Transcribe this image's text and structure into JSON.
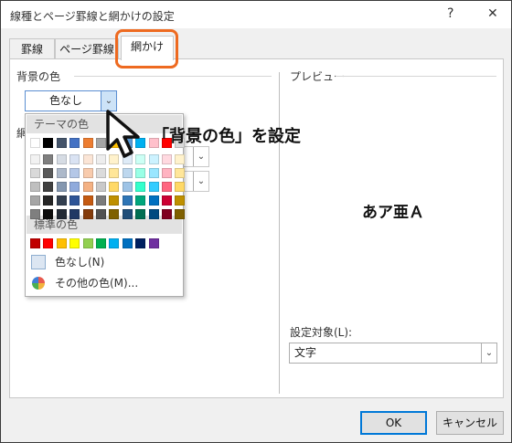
{
  "window": {
    "title": "線種とページ罫線と網かけの設定",
    "help": "?",
    "close": "✕"
  },
  "tabs": [
    {
      "label": "罫線",
      "active": false
    },
    {
      "label": "ページ罫線",
      "active": false
    },
    {
      "label": "網かけ",
      "active": true
    }
  ],
  "background": {
    "group_label": "背景の色",
    "selected_value": "色なし",
    "partial_label": "網",
    "dropdown": {
      "theme_header": "テーマの色",
      "theme_top": [
        "#ffffff",
        "#000000",
        "#44546a",
        "#4472c4",
        "#ed7d31",
        "#a5a5a5",
        "#ffc000",
        "#5b9bd5",
        "#00b0f0",
        "#ffc0cb",
        "#ff0000",
        "#d9d9d9"
      ],
      "theme_shades": [
        [
          "#f2f2f2",
          "#7f7f7f",
          "#d6dce4",
          "#dae3f3",
          "#fbe5d6",
          "#ededed",
          "#fff2cc",
          "#deebf7",
          "#ccfff5",
          "#ccf2ff",
          "#ffd9e0",
          "#fff2cc"
        ],
        [
          "#d9d9d9",
          "#595959",
          "#adb9ca",
          "#b4c7e7",
          "#f8cbad",
          "#dbdbdb",
          "#ffe699",
          "#bdd7ee",
          "#99ffe6",
          "#99e6ff",
          "#ffb3c1",
          "#ffe699"
        ],
        [
          "#bfbfbf",
          "#404040",
          "#8497b0",
          "#8faadc",
          "#f4b183",
          "#c9c9c9",
          "#ffd966",
          "#9dc3e6",
          "#33ffcc",
          "#33ccff",
          "#ff6680",
          "#ffd966"
        ],
        [
          "#a6a6a6",
          "#262626",
          "#333f50",
          "#2f5597",
          "#c55a11",
          "#7b7b7b",
          "#bf9000",
          "#2e75b6",
          "#00a67c",
          "#0070c0",
          "#cc0033",
          "#bf9000"
        ],
        [
          "#7f7f7f",
          "#0d0d0d",
          "#222a35",
          "#203864",
          "#843c0c",
          "#525252",
          "#7f6000",
          "#1f4e79",
          "#006e52",
          "#004a80",
          "#800020",
          "#7f6000"
        ]
      ],
      "standard_header": "標準の色",
      "standard": [
        "#c00000",
        "#ff0000",
        "#ffc000",
        "#ffff00",
        "#92d050",
        "#00b050",
        "#00b0f0",
        "#0070c0",
        "#002060",
        "#7030a0"
      ],
      "no_color": "色なし(N)",
      "more_colors": "その他の色(M)..."
    }
  },
  "callout": "「背景の色」を設定",
  "preview": {
    "label": "プレビュー",
    "sample": "あア亜Ａ"
  },
  "apply_to": {
    "label": "設定対象(L):",
    "value": "文字"
  },
  "buttons": {
    "ok": "OK",
    "cancel": "キャンセル"
  },
  "colors": {
    "highlight_ring": "#ee6a20",
    "focus_blue": "#0078d7"
  }
}
